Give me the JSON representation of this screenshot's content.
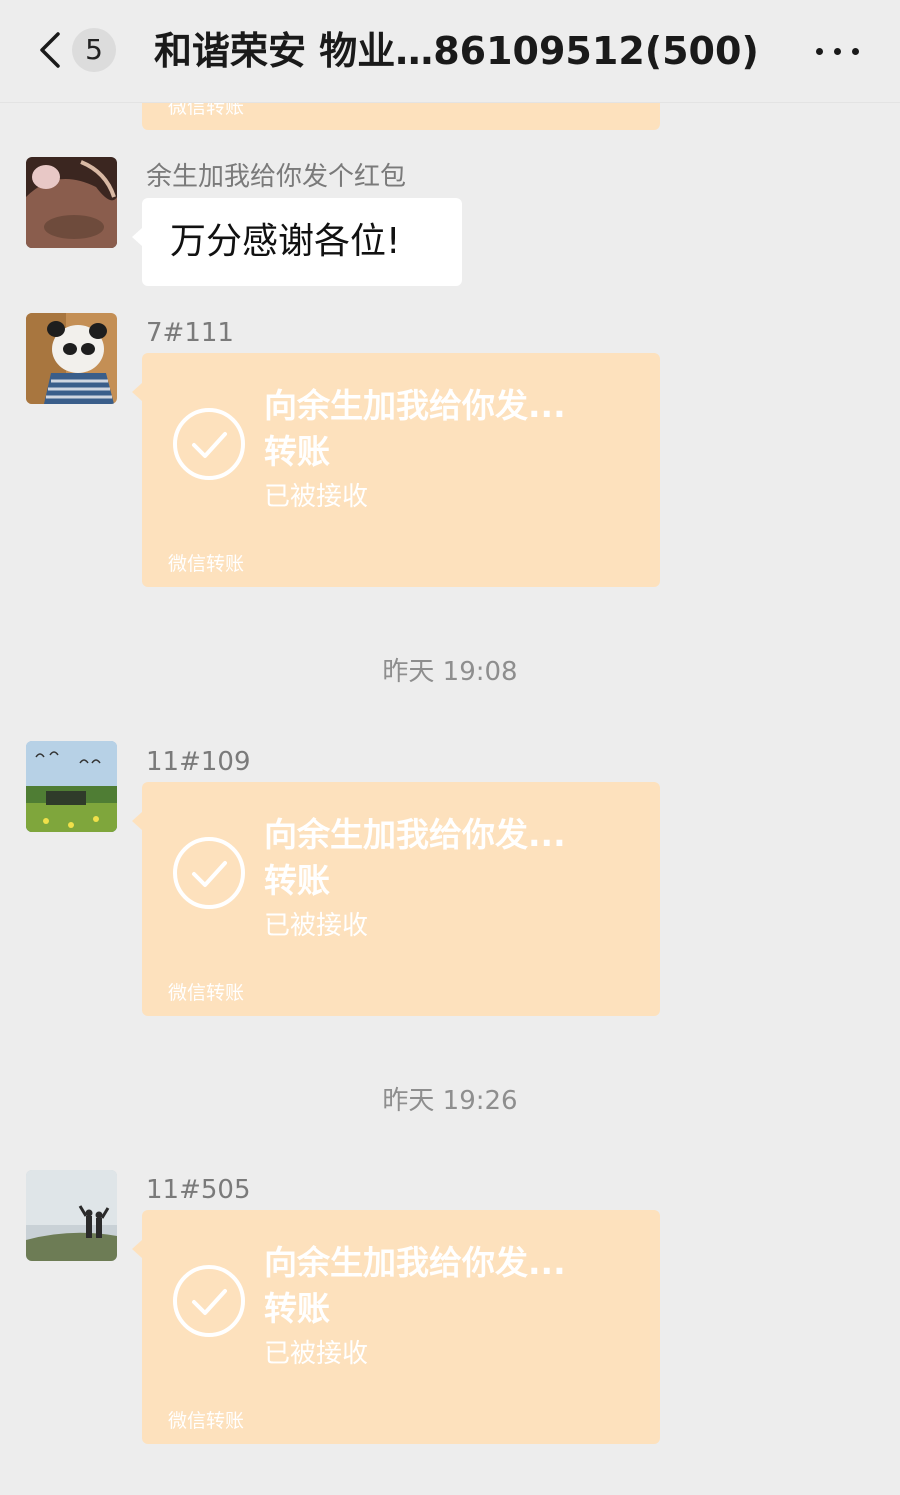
{
  "header": {
    "unread_count": "5",
    "title": "和谐荣安 物业…86109512(500)"
  },
  "messages": {
    "partial_card": {
      "footer": "微信转账"
    },
    "msg1": {
      "sender": "余生加我给你发个红包",
      "text": "万分感谢各位!"
    },
    "msg2": {
      "sender": "7#111",
      "transfer": {
        "title": "向余生加我给你发...",
        "type": "转账",
        "status": "已被接收",
        "footer": "微信转账"
      }
    },
    "time1": "昨天 19:08",
    "msg3": {
      "sender": "11#109",
      "transfer": {
        "title": "向余生加我给你发...",
        "type": "转账",
        "status": "已被接收",
        "footer": "微信转账"
      }
    },
    "time2": "昨天 19:26",
    "msg4": {
      "sender": "11#505",
      "transfer": {
        "title": "向余生加我给你发...",
        "type": "转账",
        "status": "已被接收",
        "footer": "微信转账"
      }
    }
  },
  "colors": {
    "background": "#ededed",
    "transfer_card": "#fde1bd",
    "text_bubble": "#ffffff"
  },
  "icons": {
    "back": "chevron-left-icon",
    "more": "more-dots-icon",
    "check": "check-circle-icon"
  }
}
